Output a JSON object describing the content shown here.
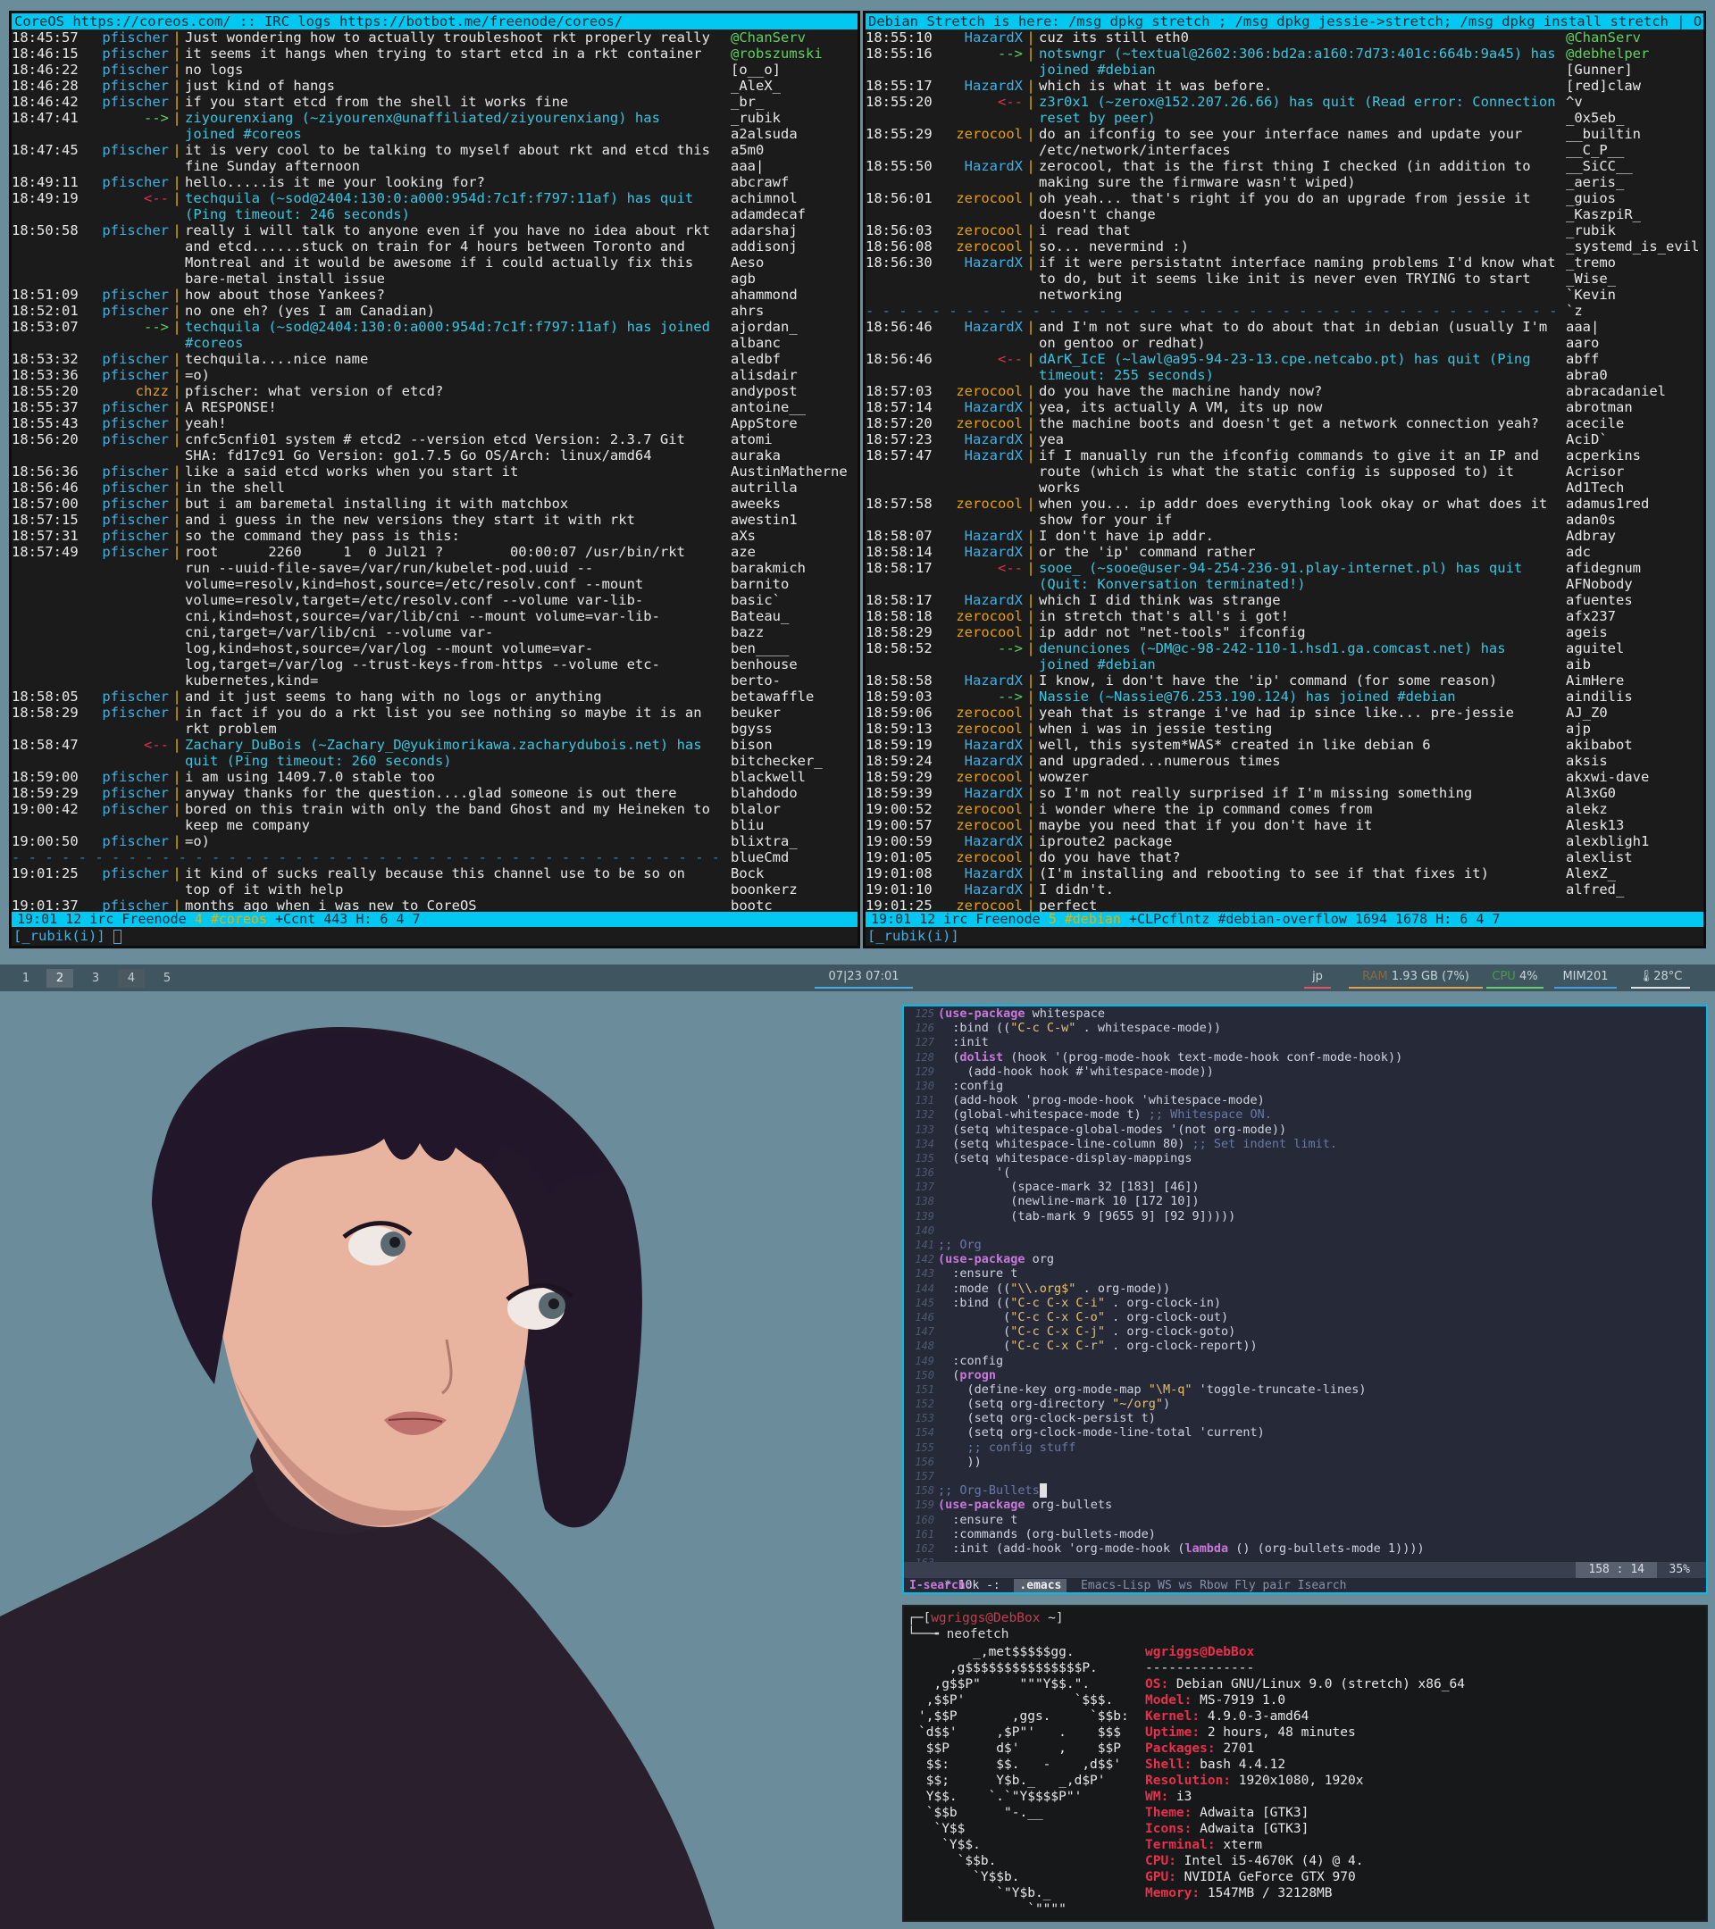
{
  "irc_left": {
    "topic": "CoreOS https://coreos.com/ :: IRC logs https://botbot.me/freenode/coreos/",
    "lines": [
      {
        "t": "18:45:57",
        "n": "pfischer",
        "m": "Just wondering how to actually troubleshoot rkt properly really"
      },
      {
        "t": "18:46:15",
        "n": "pfischer",
        "m": "it seems it hangs when trying to start etcd in a rkt container"
      },
      {
        "t": "18:46:22",
        "n": "pfischer",
        "m": "no logs"
      },
      {
        "t": "18:46:28",
        "n": "pfischer",
        "m": "just kind of hangs"
      },
      {
        "t": "18:46:42",
        "n": "pfischer",
        "m": "if you start etcd from the shell it works fine"
      },
      {
        "t": "18:47:41",
        "n": "-->",
        "m": "ziyourenxiang (~ziyourenx@unaffiliated/ziyourenxiang) has joined #coreos",
        "k": "join"
      },
      {
        "t": "18:47:45",
        "n": "pfischer",
        "m": "it is very cool to be talking to myself about rkt and etcd this fine Sunday afternoon"
      },
      {
        "t": "18:49:11",
        "n": "pfischer",
        "m": "hello.....is it me your looking for?"
      },
      {
        "t": "18:49:19",
        "n": "<--",
        "m": "techquila (~sod@2404:130:0:a000:954d:7c1f:f797:11af) has quit (Ping timeout: 246 seconds)",
        "k": "quit"
      },
      {
        "t": "18:50:58",
        "n": "pfischer",
        "m": "really i will talk to anyone even if you have no idea about rkt and etcd......stuck on train for 4 hours between Toronto and Montreal and it would be awesome if i could actually fix this bare-metal install issue"
      },
      {
        "t": "18:51:09",
        "n": "pfischer",
        "m": "how about those Yankees?"
      },
      {
        "t": "18:52:01",
        "n": "pfischer",
        "m": "no one eh? (yes I am Canadian)"
      },
      {
        "t": "18:53:07",
        "n": "-->",
        "m": "techquila (~sod@2404:130:0:a000:954d:7c1f:f797:11af) has joined #coreos",
        "k": "join"
      },
      {
        "t": "18:53:32",
        "n": "pfischer",
        "m": "techquila....nice name"
      },
      {
        "t": "18:53:36",
        "n": "pfischer",
        "m": "=o)"
      },
      {
        "t": "18:55:20",
        "n": "chzz",
        "m": "pfischer: what version of etcd?"
      },
      {
        "t": "18:55:37",
        "n": "pfischer",
        "m": "A RESPONSE!"
      },
      {
        "t": "18:55:43",
        "n": "pfischer",
        "m": "yeah!"
      },
      {
        "t": "18:56:20",
        "n": "pfischer",
        "m": "cnfc5cnfi01 system # etcd2 --version etcd Version: 2.3.7 Git SHA: fd17c91 Go Version: go1.7.5 Go OS/Arch: linux/amd64"
      },
      {
        "t": "18:56:36",
        "n": "pfischer",
        "m": "like a said etcd works when you start it"
      },
      {
        "t": "18:56:46",
        "n": "pfischer",
        "m": "in the shell"
      },
      {
        "t": "18:57:00",
        "n": "pfischer",
        "m": "but i am baremetal installing it with matchbox"
      },
      {
        "t": "18:57:15",
        "n": "pfischer",
        "m": "and i guess in the new versions they start it with rkt"
      },
      {
        "t": "18:57:31",
        "n": "pfischer",
        "m": "so the command they pass is this:"
      },
      {
        "t": "18:57:49",
        "n": "pfischer",
        "m": "root      2260     1  0 Jul21 ?        00:00:07 /usr/bin/rkt run --uuid-file-save=/var/run/kubelet-pod.uuid --volume=resolv,kind=host,source=/etc/resolv.conf --mount volume=resolv,target=/etc/resolv.conf --volume var-lib-cni,kind=host,source=/var/lib/cni --mount volume=var-lib-cni,target=/var/lib/cni --volume var-log,kind=host,source=/var/log --mount volume=var-log,target=/var/log --trust-keys-from-https --volume etc-kubernetes,kind="
      },
      {
        "t": "18:58:05",
        "n": "pfischer",
        "m": "and it just seems to hang with no logs or anything"
      },
      {
        "t": "18:58:29",
        "n": "pfischer",
        "m": "in fact if you do a rkt list you see nothing so maybe it is an rkt problem"
      },
      {
        "t": "18:58:47",
        "n": "<--",
        "m": "Zachary_DuBois (~Zachary_D@yukimorikawa.zacharydubois.net) has quit (Ping timeout: 260 seconds)",
        "k": "quit"
      },
      {
        "t": "18:59:00",
        "n": "pfischer",
        "m": "i am using 1409.7.0 stable too"
      },
      {
        "t": "18:59:29",
        "n": "pfischer",
        "m": "anyway thanks for the question....glad someone is out there"
      },
      {
        "t": "19:00:42",
        "n": "pfischer",
        "m": "bored on this train with only the band Ghost and my Heineken to keep me company"
      },
      {
        "t": "19:00:50",
        "n": "pfischer",
        "m": "=o)"
      },
      {
        "marker": true
      },
      {
        "t": "19:01:25",
        "n": "pfischer",
        "m": "it kind of sucks really because this channel use to be so on top of it with help"
      },
      {
        "t": "19:01:37",
        "n": "pfischer",
        "m": "months ago when i was new to CoreOS"
      }
    ],
    "nicks": [
      "@ChanServ",
      "@robszumski",
      "[o__o]",
      "_AleX_",
      "_br_",
      "_rubik",
      "a2alsuda",
      "a5m0",
      "aaa|",
      "abcrawf",
      "achimnol",
      "adamdecaf",
      "adarshaj",
      "addisonj",
      "Aeso",
      "agb",
      "ahammond",
      "ahrs",
      "ajordan_",
      "albanc",
      "aledbf",
      "alisdair",
      "andypost",
      "antoine__",
      "AppStore",
      "atomi",
      "auraka",
      "AustinMatherne",
      "autrilla",
      "aweeks",
      "awestin1",
      "aXs",
      "aze",
      "barakmich",
      "barnito",
      "basic`",
      "Bateau_",
      "bazz",
      "ben____",
      "benhouse",
      "berto-",
      "betawaffle",
      "beuker",
      "bgyss",
      "bison",
      "bitchecker_",
      "blackwell",
      "blahdodo",
      "blalor",
      "bliu",
      "blixtra_",
      "blueCmd",
      "Bock",
      "boonkerz",
      "bootc"
    ],
    "status": {
      "time": "19:01",
      "num": "12",
      "net": "irc Freenode",
      "chan": "4 #coreos",
      "mode": "+Ccnt",
      "users": "443",
      "h": "H: 6 4",
      "act": "7"
    },
    "input": "[_rubik(i)]"
  },
  "irc_right": {
    "topic": "Debian Stretch is here: /msg dpkg stretch ; /msg dpkg jessie->stretch; /msg dpkg install stretch | Old",
    "lines": [
      {
        "t": "18:55:10",
        "n": "HazardX",
        "m": "cuz its still eth0"
      },
      {
        "t": "18:55:16",
        "n": "-->",
        "m": "notswngr (~textual@2602:306:bd2a:a160:7d73:401c:664b:9a45) has joined #debian",
        "k": "join"
      },
      {
        "t": "18:55:17",
        "n": "HazardX",
        "m": "which is what it was before."
      },
      {
        "t": "18:55:20",
        "n": "<--",
        "m": "z3r0x1 (~zerox@152.207.26.66) has quit (Read error: Connection reset by peer)",
        "k": "quit"
      },
      {
        "t": "18:55:29",
        "n": "zerocool",
        "m": "do an ifconfig to see your interface names and update your /etc/network/interfaces"
      },
      {
        "t": "18:55:50",
        "n": "HazardX",
        "m": "zerocool, that is the first thing I checked (in addition to making sure the firmware wasn't wiped)"
      },
      {
        "t": "18:56:01",
        "n": "zerocool",
        "m": "oh yeah... that's right if you do an upgrade from jessie it doesn't change"
      },
      {
        "t": "18:56:03",
        "n": "zerocool",
        "m": "i read that"
      },
      {
        "t": "18:56:08",
        "n": "zerocool",
        "m": "so... nevermind :)"
      },
      {
        "t": "18:56:30",
        "n": "HazardX",
        "m": "if it were persistatnt interface naming problems I'd know what to do, but it seems like init is never even TRYING to start networking"
      },
      {
        "marker": true
      },
      {
        "t": "18:56:46",
        "n": "HazardX",
        "m": "and I'm not sure what to do about that in debian (usually I'm on gentoo or redhat)"
      },
      {
        "t": "18:56:46",
        "n": "<--",
        "m": "dArK_IcE (~lawl@a95-94-23-13.cpe.netcabo.pt) has quit (Ping timeout: 255 seconds)",
        "k": "quit"
      },
      {
        "t": "18:57:03",
        "n": "zerocool",
        "m": "do you have the machine handy now?"
      },
      {
        "t": "18:57:14",
        "n": "HazardX",
        "m": "yea, its actually A VM, its up now"
      },
      {
        "t": "18:57:20",
        "n": "zerocool",
        "m": "the machine boots and doesn't get a network connection yeah?"
      },
      {
        "t": "18:57:23",
        "n": "HazardX",
        "m": "yea"
      },
      {
        "t": "18:57:47",
        "n": "HazardX",
        "m": "if I manually run the ifconfig commands to give it an IP and route (which is what the static config is supposed to) it works"
      },
      {
        "t": "18:57:58",
        "n": "zerocool",
        "m": "when you... ip addr does everything look okay or what does it show for your if"
      },
      {
        "t": "18:58:07",
        "n": "HazardX",
        "m": "I don't have ip addr."
      },
      {
        "t": "18:58:14",
        "n": "HazardX",
        "m": "or the 'ip' command rather"
      },
      {
        "t": "18:58:17",
        "n": "<--",
        "m": "sooe_ (~sooe@user-94-254-236-91.play-internet.pl) has quit (Quit: Konversation terminated!)",
        "k": "quit"
      },
      {
        "t": "18:58:17",
        "n": "HazardX",
        "m": "which I did think was strange"
      },
      {
        "t": "18:58:18",
        "n": "zerocool",
        "m": "in stretch that's all's i got!"
      },
      {
        "t": "18:58:29",
        "n": "zerocool",
        "m": "ip addr not \"net-tools\" ifconfig"
      },
      {
        "t": "18:58:52",
        "n": "-->",
        "m": "denunciones (~DM@c-98-242-110-1.hsd1.ga.comcast.net) has joined #debian",
        "k": "join"
      },
      {
        "t": "18:58:58",
        "n": "HazardX",
        "m": "I know, i don't have the 'ip' command (for some reason)"
      },
      {
        "t": "18:59:03",
        "n": "-->",
        "m": "Nassie (~Nassie@76.253.190.124) has joined #debian",
        "k": "join"
      },
      {
        "t": "18:59:06",
        "n": "zerocool",
        "m": "yeah that is strange i've had ip since like... pre-jessie"
      },
      {
        "t": "18:59:13",
        "n": "zerocool",
        "m": "when i was in jessie testing"
      },
      {
        "t": "18:59:19",
        "n": "HazardX",
        "m": "well, this system*WAS* created in like debian 6"
      },
      {
        "t": "18:59:24",
        "n": "HazardX",
        "m": "and upgraded...numerous times"
      },
      {
        "t": "18:59:29",
        "n": "zerocool",
        "m": "wowzer"
      },
      {
        "t": "18:59:39",
        "n": "HazardX",
        "m": "so I'm not really surprised if I'm missing something"
      },
      {
        "t": "19:00:52",
        "n": "zerocool",
        "m": "i wonder where the ip command comes from"
      },
      {
        "t": "19:00:57",
        "n": "zerocool",
        "m": "maybe you need that if you don't have it"
      },
      {
        "t": "19:00:59",
        "n": "HazardX",
        "m": "iproute2 package"
      },
      {
        "t": "19:01:05",
        "n": "zerocool",
        "m": "do you have that?"
      },
      {
        "t": "19:01:08",
        "n": "HazardX",
        "m": "(I'm installing and rebooting to see if that fixes it)"
      },
      {
        "t": "19:01:10",
        "n": "HazardX",
        "m": "I didn't."
      },
      {
        "t": "19:01:25",
        "n": "zerocool",
        "m": "perfect"
      }
    ],
    "nicks": [
      "@ChanServ",
      "@debhelper",
      "[Gunner]",
      "[red]claw",
      "^v",
      "_0x5eb_",
      "__builtin",
      "__C_P__",
      "__SiCC__",
      "_aeris_",
      "_guios",
      "_KaszpiR_",
      "_rubik",
      "_systemd_is_evil",
      "_tremo",
      "_Wise_",
      "`Kevin",
      "`z",
      "aaa|",
      "aaro",
      "abff",
      "abra0",
      "abracadaniel",
      "abrotman",
      "acecile",
      "AciD`",
      "acperkins",
      "Acrisor",
      "Ad1Tech",
      "adamus1red",
      "adan0s",
      "Adbray",
      "adc",
      "afidegnum",
      "AFNobody",
      "afuentes",
      "afx237",
      "ageis",
      "aguitel",
      "aib",
      "AimHere",
      "aindilis",
      "AJ_Z0",
      "ajp",
      "akibabot",
      "aksis",
      "akxwi-dave",
      "Al3xG0",
      "alekz",
      "Alesk13",
      "alexbligh1",
      "alexlist",
      "AlexZ_",
      "alfred_"
    ],
    "status": {
      "time": "19:01",
      "num": "12",
      "net": "irc Freenode",
      "chan": "5 #debian",
      "mode": "+CLPcflntz",
      "extra": "#debian-overflow 1694",
      "users": "1678",
      "h": "H: 6 4",
      "act": "7"
    },
    "input": "[_rubik(i)]"
  },
  "i3bar": {
    "workspaces": [
      "1",
      "2",
      "3",
      "4",
      "5"
    ],
    "datetime": "07|23 07:01",
    "lang": "jp",
    "ram_label": "RAM",
    "ram": "1.93 GB (7%)",
    "cpu_label": "CPU",
    "cpu": "4%",
    "mail": "MIM201",
    "temp": "28°C",
    "colors": {
      "lang": "#e85060",
      "ram": "#e8a048",
      "cpu": "#60d060",
      "mail": "#40a0e8",
      "temp": "#e0e0e0"
    }
  },
  "emacs": {
    "lines": [
      {
        "n": "125",
        "c": "<k>(use-package</k> whitespace"
      },
      {
        "n": "126",
        "c": "  :bind ((<s>\"C-c C-w\"</s> . whitespace-mode))"
      },
      {
        "n": "127",
        "c": "  :init"
      },
      {
        "n": "128",
        "c": "  (<k>dolist</k> (hook '(prog-mode-hook text-mode-hook conf-mode-hook))"
      },
      {
        "n": "129",
        "c": "    (add-hook hook #'whitespace-mode))"
      },
      {
        "n": "130",
        "c": "  :config"
      },
      {
        "n": "131",
        "c": "  (add-hook 'prog-mode-hook 'whitespace-mode)"
      },
      {
        "n": "132",
        "c": "  (global-whitespace-mode t) <c>;; Whitespace ON.</c>"
      },
      {
        "n": "133",
        "c": "  (setq whitespace-global-modes '(not org-mode))"
      },
      {
        "n": "134",
        "c": "  (setq whitespace-line-column 80) <c>;; Set indent limit.</c>"
      },
      {
        "n": "135",
        "c": "  (setq whitespace-display-mappings"
      },
      {
        "n": "136",
        "c": "        '("
      },
      {
        "n": "137",
        "c": "          (space-mark 32 [183] [46])"
      },
      {
        "n": "138",
        "c": "          (newline-mark 10 [172 10])"
      },
      {
        "n": "139",
        "c": "          (tab-mark 9 [9655 9] [92 9]))))"
      },
      {
        "n": "140",
        "c": ""
      },
      {
        "n": "141",
        "c": "<c>;; Org</c>"
      },
      {
        "n": "142",
        "c": "<k>(use-package</k> org"
      },
      {
        "n": "143",
        "c": "  :ensure t"
      },
      {
        "n": "144",
        "c": "  :mode ((<s>\"\\\\.org$\"</s> . org-mode))"
      },
      {
        "n": "145",
        "c": "  :bind ((<s>\"C-c C-x C-i\"</s> . org-clock-in)"
      },
      {
        "n": "146",
        "c": "         (<s>\"C-c C-x C-o\"</s> . org-clock-out)"
      },
      {
        "n": "147",
        "c": "         (<s>\"C-c C-x C-j\"</s> . org-clock-goto)"
      },
      {
        "n": "148",
        "c": "         (<s>\"C-c C-x C-r\"</s> . org-clock-report))"
      },
      {
        "n": "149",
        "c": "  :config"
      },
      {
        "n": "150",
        "c": "  (<k>progn</k>"
      },
      {
        "n": "151",
        "c": "    (define-key org-mode-map <s>\"\\M-q\"</s> 'toggle-truncate-lines)"
      },
      {
        "n": "152",
        "c": "    (setq org-directory <s>\"~/org\"</s>)"
      },
      {
        "n": "153",
        "c": "    (setq org-clock-persist t)"
      },
      {
        "n": "154",
        "c": "    (setq org-clock-mode-line-total 'current)"
      },
      {
        "n": "155",
        "c": "    <c>;; config stuff</c>"
      },
      {
        "n": "156",
        "c": "    ))"
      },
      {
        "n": "157",
        "c": ""
      },
      {
        "n": "158",
        "c": "<c>;; Org-Bullets</c>"
      },
      {
        "n": "159",
        "c": "<k>(use-package</k> org-bullets"
      },
      {
        "n": "160",
        "c": "  :ensure t"
      },
      {
        "n": "161",
        "c": "  :commands (org-bullets-mode)"
      },
      {
        "n": "162",
        "c": "  :init (add-hook 'org-mode-hook (<k>lambda</k> () (org-bullets-mode 1))))"
      },
      {
        "n": "163",
        "c": ""
      }
    ],
    "modeline": {
      "flags": " * 10k -:",
      "buffer": ".emacs",
      "modes": "Emacs-Lisp WS ws Rbow Fly pair Isearch",
      "pos": "158 : 14",
      "pct": "35%"
    },
    "echo": "I-search:"
  },
  "terminal": {
    "prompt_open": "┌─[",
    "user_host": "wgriggs@DebBox",
    "prompt_dir": " ~]",
    "prompt_arrow": "└──╼ ",
    "command": "neofetch",
    "logo": [
      "       _,met$$$$$gg.",
      "    ,g$$$$$$$$$$$$$$$P.",
      "  ,g$$P\"     \"\"\"Y$$.\".",
      " ,$$P'              `$$$.",
      "',$$P       ,ggs.     `$$b:",
      "`d$$'     ,$P\"'   .    $$$",
      " $$P      d$'     ,    $$P",
      " $$:      $$.   -    ,d$$'",
      " $$;      Y$b._   _,d$P'",
      " Y$$.    `.`\"Y$$$$P\"'",
      " `$$b      \"-.__",
      "  `Y$$",
      "   `Y$$.",
      "     `$$b.",
      "       `Y$$b.",
      "          `\"Y$b._",
      "              `\"\"\"\""
    ],
    "info_title": "wgriggs@DebBox",
    "info_sep": "--------------",
    "info": [
      {
        "k": "OS",
        "v": "Debian GNU/Linux 9.0 (stretch) x86_64"
      },
      {
        "k": "Model",
        "v": "MS-7919 1.0"
      },
      {
        "k": "Kernel",
        "v": "4.9.0-3-amd64"
      },
      {
        "k": "Uptime",
        "v": "2 hours, 48 minutes"
      },
      {
        "k": "Packages",
        "v": "2701"
      },
      {
        "k": "Shell",
        "v": "bash 4.4.12"
      },
      {
        "k": "Resolution",
        "v": "1920x1080, 1920x"
      },
      {
        "k": "WM",
        "v": "i3"
      },
      {
        "k": "Theme",
        "v": "Adwaita [GTK3]"
      },
      {
        "k": "Icons",
        "v": "Adwaita [GTK3]"
      },
      {
        "k": "Terminal",
        "v": "xterm"
      },
      {
        "k": "CPU",
        "v": "Intel i5-4670K (4) @ 4."
      },
      {
        "k": "GPU",
        "v": "NVIDIA GeForce GTX 970"
      },
      {
        "k": "Memory",
        "v": "1547MB / 32128MB"
      }
    ]
  }
}
